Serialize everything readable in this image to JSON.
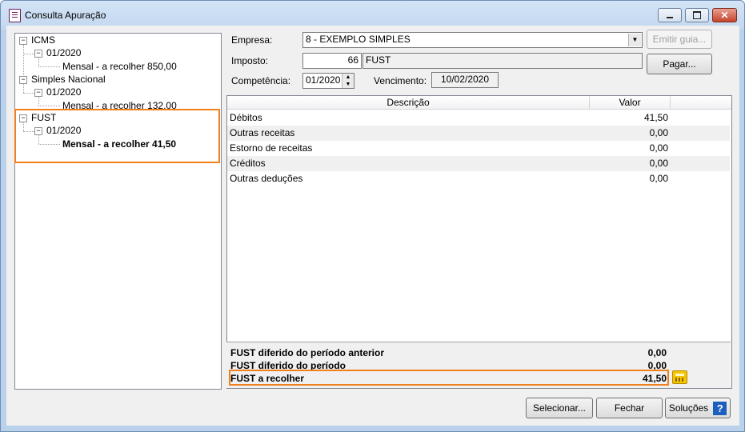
{
  "window": {
    "title": "Consulta Apuração"
  },
  "tree": {
    "nodes": [
      {
        "label": "ICMS",
        "toggle": "−"
      },
      {
        "label": "01/2020",
        "toggle": "−"
      },
      {
        "label": "Mensal - a recolher 850,00"
      },
      {
        "label": "Simples Nacional",
        "toggle": "−"
      },
      {
        "label": "01/2020",
        "toggle": "−"
      },
      {
        "label": "Mensal - a recolher 132,00"
      },
      {
        "label": "FUST",
        "toggle": "−"
      },
      {
        "label": "01/2020",
        "toggle": "−"
      },
      {
        "label": "Mensal - a recolher 41,50"
      }
    ]
  },
  "form": {
    "empresa_label": "Empresa:",
    "empresa_value": "8 - EXEMPLO SIMPLES",
    "imposto_label": "Imposto:",
    "imposto_code": "66",
    "imposto_name": "FUST",
    "competencia_label": "Competência:",
    "competencia_value": "01/2020",
    "vencimento_label": "Vencimento:",
    "vencimento_value": "10/02/2020"
  },
  "buttons": {
    "emitir_guia": "Emitir guia...",
    "pagar": "Pagar...",
    "selecionar": "Selecionar...",
    "fechar": "Fechar",
    "solucoes": "Soluções"
  },
  "grid": {
    "columns": [
      "Descrição",
      "Valor"
    ],
    "rows": [
      {
        "desc": "Débitos",
        "value": "41,50"
      },
      {
        "desc": "Outras receitas",
        "value": "0,00"
      },
      {
        "desc": "Estorno de receitas",
        "value": "0,00"
      },
      {
        "desc": "Créditos",
        "value": "0,00"
      },
      {
        "desc": "Outras deduções",
        "value": "0,00"
      }
    ]
  },
  "summary": [
    {
      "label": "FUST diferido do período anterior",
      "value": "0,00"
    },
    {
      "label": "FUST diferido do período",
      "value": "0,00"
    },
    {
      "label": "FUST a recolher",
      "value": "41,50"
    }
  ],
  "colors": {
    "highlight": "#f07f1c",
    "help": "#1d5fbf",
    "calc": "#f5c600"
  }
}
